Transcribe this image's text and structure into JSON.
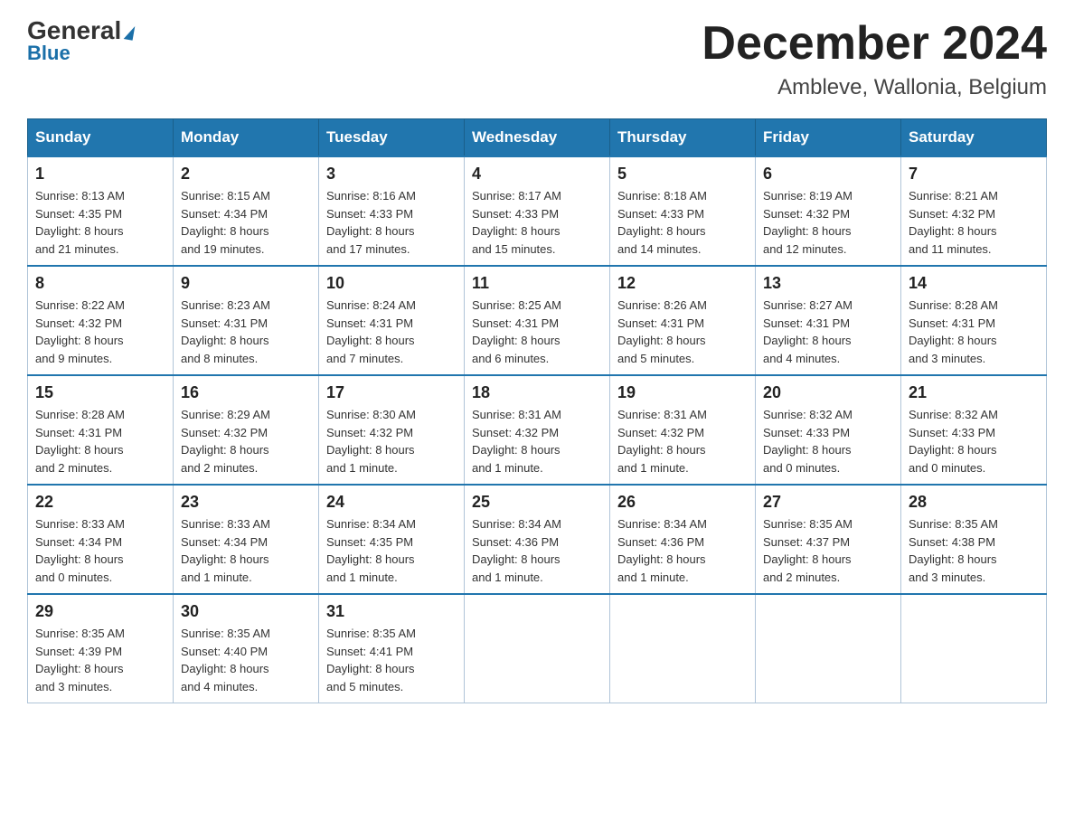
{
  "header": {
    "logo_general": "General",
    "logo_blue": "Blue",
    "month_title": "December 2024",
    "location": "Ambleve, Wallonia, Belgium"
  },
  "weekdays": [
    "Sunday",
    "Monday",
    "Tuesday",
    "Wednesday",
    "Thursday",
    "Friday",
    "Saturday"
  ],
  "weeks": [
    [
      {
        "day": "1",
        "sunrise": "8:13 AM",
        "sunset": "4:35 PM",
        "daylight": "8 hours and 21 minutes."
      },
      {
        "day": "2",
        "sunrise": "8:15 AM",
        "sunset": "4:34 PM",
        "daylight": "8 hours and 19 minutes."
      },
      {
        "day": "3",
        "sunrise": "8:16 AM",
        "sunset": "4:33 PM",
        "daylight": "8 hours and 17 minutes."
      },
      {
        "day": "4",
        "sunrise": "8:17 AM",
        "sunset": "4:33 PM",
        "daylight": "8 hours and 15 minutes."
      },
      {
        "day": "5",
        "sunrise": "8:18 AM",
        "sunset": "4:33 PM",
        "daylight": "8 hours and 14 minutes."
      },
      {
        "day": "6",
        "sunrise": "8:19 AM",
        "sunset": "4:32 PM",
        "daylight": "8 hours and 12 minutes."
      },
      {
        "day": "7",
        "sunrise": "8:21 AM",
        "sunset": "4:32 PM",
        "daylight": "8 hours and 11 minutes."
      }
    ],
    [
      {
        "day": "8",
        "sunrise": "8:22 AM",
        "sunset": "4:32 PM",
        "daylight": "8 hours and 9 minutes."
      },
      {
        "day": "9",
        "sunrise": "8:23 AM",
        "sunset": "4:31 PM",
        "daylight": "8 hours and 8 minutes."
      },
      {
        "day": "10",
        "sunrise": "8:24 AM",
        "sunset": "4:31 PM",
        "daylight": "8 hours and 7 minutes."
      },
      {
        "day": "11",
        "sunrise": "8:25 AM",
        "sunset": "4:31 PM",
        "daylight": "8 hours and 6 minutes."
      },
      {
        "day": "12",
        "sunrise": "8:26 AM",
        "sunset": "4:31 PM",
        "daylight": "8 hours and 5 minutes."
      },
      {
        "day": "13",
        "sunrise": "8:27 AM",
        "sunset": "4:31 PM",
        "daylight": "8 hours and 4 minutes."
      },
      {
        "day": "14",
        "sunrise": "8:28 AM",
        "sunset": "4:31 PM",
        "daylight": "8 hours and 3 minutes."
      }
    ],
    [
      {
        "day": "15",
        "sunrise": "8:28 AM",
        "sunset": "4:31 PM",
        "daylight": "8 hours and 2 minutes."
      },
      {
        "day": "16",
        "sunrise": "8:29 AM",
        "sunset": "4:32 PM",
        "daylight": "8 hours and 2 minutes."
      },
      {
        "day": "17",
        "sunrise": "8:30 AM",
        "sunset": "4:32 PM",
        "daylight": "8 hours and 1 minute."
      },
      {
        "day": "18",
        "sunrise": "8:31 AM",
        "sunset": "4:32 PM",
        "daylight": "8 hours and 1 minute."
      },
      {
        "day": "19",
        "sunrise": "8:31 AM",
        "sunset": "4:32 PM",
        "daylight": "8 hours and 1 minute."
      },
      {
        "day": "20",
        "sunrise": "8:32 AM",
        "sunset": "4:33 PM",
        "daylight": "8 hours and 0 minutes."
      },
      {
        "day": "21",
        "sunrise": "8:32 AM",
        "sunset": "4:33 PM",
        "daylight": "8 hours and 0 minutes."
      }
    ],
    [
      {
        "day": "22",
        "sunrise": "8:33 AM",
        "sunset": "4:34 PM",
        "daylight": "8 hours and 0 minutes."
      },
      {
        "day": "23",
        "sunrise": "8:33 AM",
        "sunset": "4:34 PM",
        "daylight": "8 hours and 1 minute."
      },
      {
        "day": "24",
        "sunrise": "8:34 AM",
        "sunset": "4:35 PM",
        "daylight": "8 hours and 1 minute."
      },
      {
        "day": "25",
        "sunrise": "8:34 AM",
        "sunset": "4:36 PM",
        "daylight": "8 hours and 1 minute."
      },
      {
        "day": "26",
        "sunrise": "8:34 AM",
        "sunset": "4:36 PM",
        "daylight": "8 hours and 1 minute."
      },
      {
        "day": "27",
        "sunrise": "8:35 AM",
        "sunset": "4:37 PM",
        "daylight": "8 hours and 2 minutes."
      },
      {
        "day": "28",
        "sunrise": "8:35 AM",
        "sunset": "4:38 PM",
        "daylight": "8 hours and 3 minutes."
      }
    ],
    [
      {
        "day": "29",
        "sunrise": "8:35 AM",
        "sunset": "4:39 PM",
        "daylight": "8 hours and 3 minutes."
      },
      {
        "day": "30",
        "sunrise": "8:35 AM",
        "sunset": "4:40 PM",
        "daylight": "8 hours and 4 minutes."
      },
      {
        "day": "31",
        "sunrise": "8:35 AM",
        "sunset": "4:41 PM",
        "daylight": "8 hours and 5 minutes."
      },
      null,
      null,
      null,
      null
    ]
  ],
  "labels": {
    "sunrise": "Sunrise:",
    "sunset": "Sunset:",
    "daylight": "Daylight:"
  }
}
